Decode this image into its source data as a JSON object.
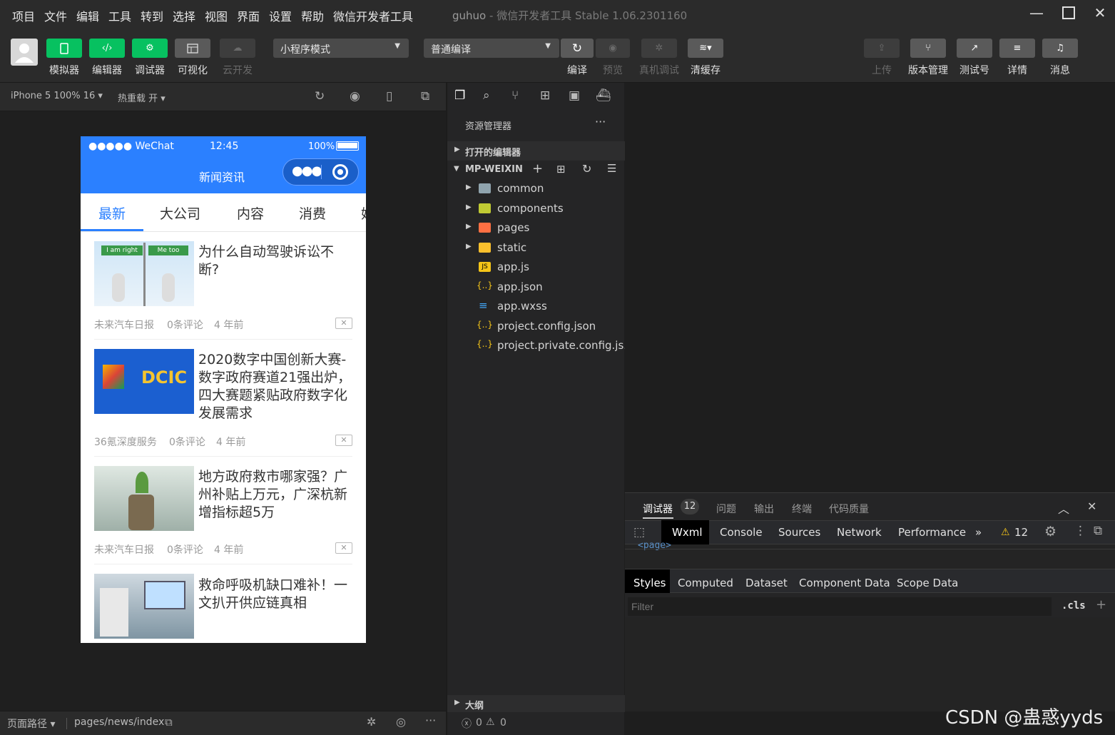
{
  "menubar": {
    "items": [
      "项目",
      "文件",
      "编辑",
      "工具",
      "转到",
      "选择",
      "视图",
      "界面",
      "设置",
      "帮助",
      "微信开发者工具"
    ],
    "title_project": "guhuo",
    "title_sep": " - ",
    "title_app": "微信开发者工具 Stable 1.06.2301160"
  },
  "toolbar": {
    "simulator": "模拟器",
    "editor": "编辑器",
    "debugger": "调试器",
    "visual": "可视化",
    "cloud": "云开发",
    "mode_select": "小程序模式",
    "compile_select": "普通编译",
    "compile": "编译",
    "preview": "预览",
    "remote_debug": "真机调试",
    "clear_cache": "清缓存",
    "upload": "上传",
    "version_mgmt": "版本管理",
    "test_no": "测试号",
    "details": "详情",
    "messages": "消息"
  },
  "sim_toolbar": {
    "device": "iPhone 5 100% 16",
    "hot_reload": "热重载 开"
  },
  "phone": {
    "carrier": "●●●●● WeChat",
    "time": "12:45",
    "battery": "100%",
    "nav_title": "新闻资讯",
    "tabs": [
      "最新",
      "大公司",
      "内容",
      "消费",
      "娱"
    ],
    "news": [
      {
        "title": "为什么自动驾驶诉讼不断?",
        "source": "未来汽车日报",
        "comments": "0条评论",
        "time": "4 年前",
        "sign_left": "I am right",
        "sign_right": "Me too"
      },
      {
        "title": "2020数字中国创新大赛-数字政府赛道21强出炉，四大赛题紧贴政府数字化发展需求",
        "source": "36氪深度服务",
        "comments": "0条评论",
        "time": "4 年前",
        "logo": "DCIC"
      },
      {
        "title": "地方政府救市哪家强？广州补贴上万元，广深杭新增指标超5万",
        "source": "未来汽车日报",
        "comments": "0条评论",
        "time": "4 年前"
      },
      {
        "title": "救命呼吸机缺口难补！一文扒开供应链真相",
        "source": "",
        "comments": "",
        "time": ""
      }
    ],
    "close_glyph": "✕"
  },
  "sim_bottom": {
    "page_path_label": "页面路径",
    "page_path": "pages/news/index"
  },
  "explorer": {
    "title": "资源管理器",
    "more": "···",
    "open_editors": "打开的编辑器",
    "root": "MP-WEIXIN",
    "files": [
      {
        "name": "common",
        "type": "folder",
        "color": "#90a4ae"
      },
      {
        "name": "components",
        "type": "folder",
        "color": "#c0ca33"
      },
      {
        "name": "pages",
        "type": "folder",
        "color": "#ff7043"
      },
      {
        "name": "static",
        "type": "folder",
        "color": "#fbc02d"
      },
      {
        "name": "app.js",
        "type": "js",
        "color": "#f5c518"
      },
      {
        "name": "app.json",
        "type": "json",
        "color": "#f5c518"
      },
      {
        "name": "app.wxss",
        "type": "css",
        "color": "#42a5f5"
      },
      {
        "name": "project.config.json",
        "type": "json",
        "color": "#f5c518"
      },
      {
        "name": "project.private.config.js...",
        "type": "json",
        "color": "#f5c518"
      }
    ],
    "outline": "大纲",
    "errors": "0",
    "warnings": "0"
  },
  "debugger": {
    "tabs": [
      "调试器",
      "问题",
      "输出",
      "终端",
      "代码质量"
    ],
    "badge": "12",
    "devtools_tabs": [
      "Wxml",
      "Console",
      "Sources",
      "Network",
      "Performance"
    ],
    "more": "»",
    "warn_count": "12",
    "wxml_snippet": "<page>",
    "style_tabs": [
      "Styles",
      "Computed",
      "Dataset",
      "Component Data",
      "Scope Data"
    ],
    "filter_placeholder": "Filter",
    "cls": ".cls",
    "plus": "+"
  },
  "watermark": "CSDN @蛊惑yyds"
}
